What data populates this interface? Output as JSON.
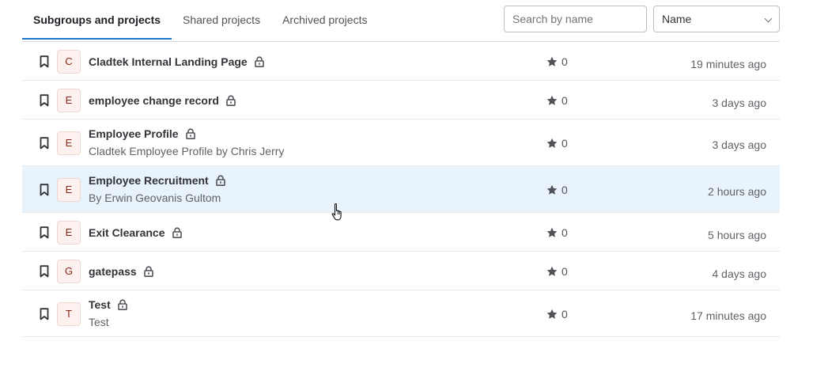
{
  "tabs": [
    {
      "label": "Subgroups and projects",
      "active": true
    },
    {
      "label": "Shared projects",
      "active": false
    },
    {
      "label": "Archived projects",
      "active": false
    }
  ],
  "search": {
    "placeholder": "Search by name",
    "value": ""
  },
  "sort": {
    "selected": "Name"
  },
  "colors": {
    "accent": "#1f75cb",
    "hover_row": "#e9f3fc",
    "avatar_bg": "#fcf1ef"
  },
  "projects": [
    {
      "initial": "C",
      "name": "Cladtek Internal Landing Page",
      "description": "",
      "stars": "0",
      "updated": "19 minutes ago"
    },
    {
      "initial": "E",
      "name": "employee change record",
      "description": "",
      "stars": "0",
      "updated": "3 days ago"
    },
    {
      "initial": "E",
      "name": "Employee Profile",
      "description": "Cladtek Employee Profile by Chris Jerry",
      "stars": "0",
      "updated": "3 days ago"
    },
    {
      "initial": "E",
      "name": "Employee Recruitment",
      "description": "By Erwin Geovanis Gultom",
      "stars": "0",
      "updated": "2 hours ago"
    },
    {
      "initial": "E",
      "name": "Exit Clearance",
      "description": "",
      "stars": "0",
      "updated": "5 hours ago"
    },
    {
      "initial": "G",
      "name": "gatepass",
      "description": "",
      "stars": "0",
      "updated": "4 days ago"
    },
    {
      "initial": "T",
      "name": "Test",
      "description": "Test",
      "stars": "0",
      "updated": "17 minutes ago"
    }
  ]
}
